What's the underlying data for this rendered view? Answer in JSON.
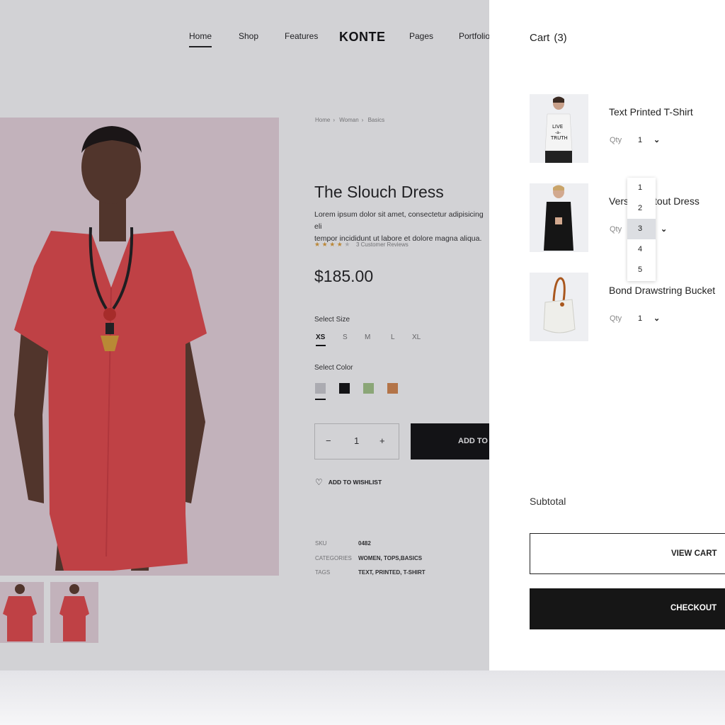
{
  "nav": {
    "items": [
      "Home",
      "Shop",
      "Features",
      "Pages",
      "Portfolio"
    ],
    "logo": "KONTE",
    "active": "Home"
  },
  "breadcrumb": [
    "Home",
    "Woman",
    "Basics"
  ],
  "product": {
    "title": "The Slouch Dress",
    "description_line1": "Lorem ipsum dolor sit amet, consectetur adipisicing eli",
    "description_line2": "tempor incididunt ut labore et dolore magna aliqua.",
    "rating": 4,
    "rating_max": 5,
    "reviews": "3 Customer Reviews",
    "price": "$185.00",
    "select_size_label": "Select Size",
    "sizes": [
      "XS",
      "S",
      "M",
      "L",
      "XL"
    ],
    "selected_size": "XS",
    "select_color_label": "Select Color",
    "colors": [
      "#cfcfd3",
      "#111111",
      "#a7c98a",
      "#d98a4f"
    ],
    "quantity": "1",
    "minus": "−",
    "plus": "+",
    "add_to_cart": "ADD TO",
    "wishlist": "ADD TO WISHLIST",
    "meta": {
      "sku_label": "SKU",
      "sku": "0482",
      "categories_label": "CATEGORIES",
      "categories": "WOMEN, TOPS,BASICS",
      "tags_label": "TAGS",
      "tags": "TEXT, PRINTED, T-SHIRT"
    }
  },
  "cart": {
    "title": "Cart",
    "count": "(3)",
    "qty_label": "Qty",
    "items": [
      {
        "name": "Text Printed T-Shirt",
        "qty": "1"
      },
      {
        "name_left": "Vers",
        "name_right": "tout Dress",
        "qty": "3"
      },
      {
        "name": "Bond Drawstring Bucket",
        "qty": "1"
      }
    ],
    "qty_options": [
      "1",
      "2",
      "3",
      "4",
      "5"
    ],
    "selected_qty": "3",
    "subtotal_label": "Subtotal",
    "view_cart": "VIEW CART",
    "checkout": "CHECKOUT"
  },
  "colors": {
    "hero_bg": "#ecd7df",
    "dress": "#e84a4c",
    "overlay": "rgba(28,30,45,0.2)",
    "button_dark": "#161616",
    "star": "#e2a23a"
  }
}
